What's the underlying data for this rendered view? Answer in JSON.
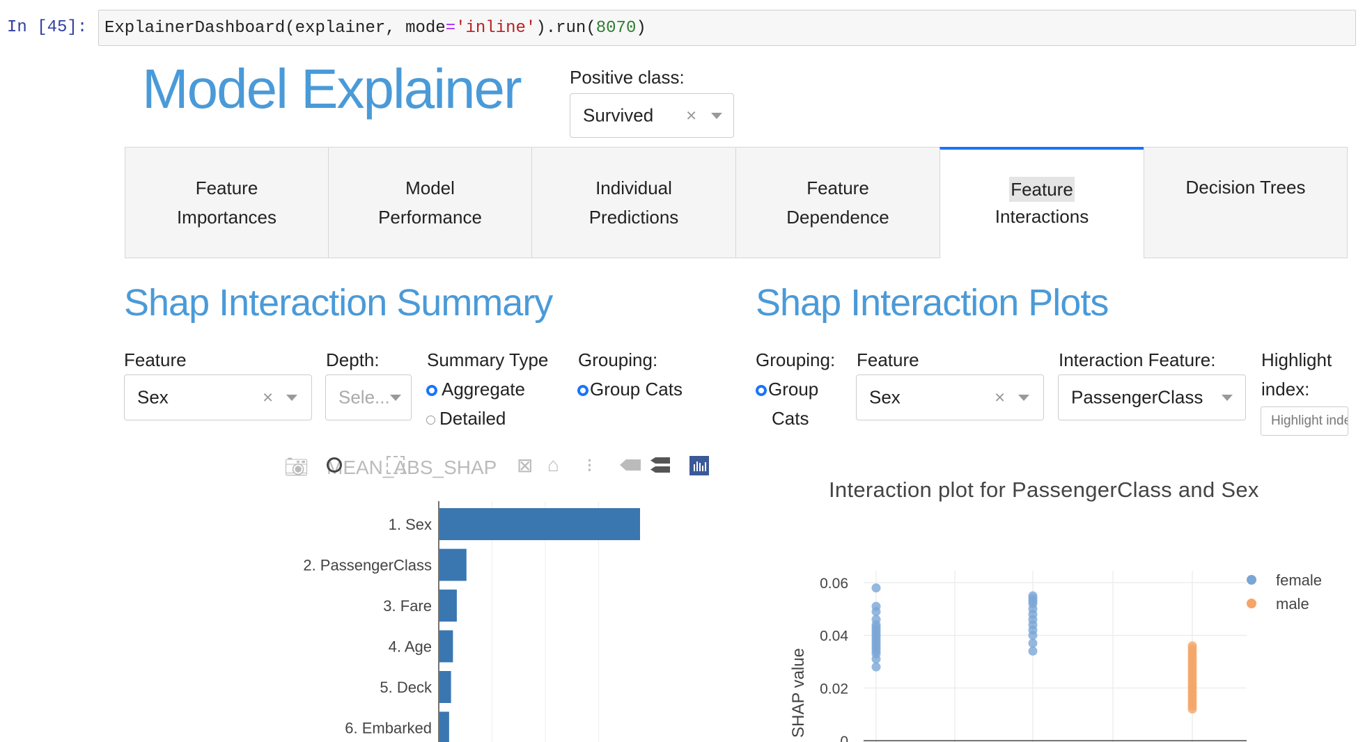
{
  "cell": {
    "prompt": "In [45]:",
    "code_prefix": "ExplainerDashboard(explainer, mode",
    "code_eq": "=",
    "code_str": "'inline'",
    "code_mid": ").run(",
    "code_num": "8070",
    "code_end": ")"
  },
  "header": {
    "title": "Model Explainer",
    "positive_class_label": "Positive class:",
    "positive_class_value": "Survived"
  },
  "tabs": [
    {
      "line1": "Feature",
      "line2": "Importances"
    },
    {
      "line1": "Model",
      "line2": "Performance"
    },
    {
      "line1": "Individual",
      "line2": "Predictions"
    },
    {
      "line1": "Feature",
      "line2": "Dependence"
    },
    {
      "line1": "Feature",
      "line2": "Interactions"
    },
    {
      "line1": "Decision Trees",
      "line2": ""
    }
  ],
  "summary": {
    "title": "Shap Interaction Summary",
    "feature_label": "Feature",
    "feature_value": "Sex",
    "depth_label": "Depth:",
    "depth_placeholder": "Sele...",
    "summary_type_label": "Summary Type",
    "summary_opt_aggregate": "Aggregate",
    "summary_opt_detailed": "Detailed",
    "grouping_label": "Grouping:",
    "grouping_opt": "Group Cats",
    "plot_title_overlay": "MEAN_ABS_SHAP"
  },
  "plots": {
    "title": "Shap Interaction Plots",
    "grouping_label": "Grouping:",
    "grouping_opt_line1": "Group",
    "grouping_opt_line2": "Cats",
    "feature_label": "Feature",
    "feature_value": "Sex",
    "interaction_label": "Interaction Feature:",
    "interaction_value": "PassengerClass",
    "highlight_label_line1": "Highlight",
    "highlight_label_line2": "index:",
    "highlight_placeholder": "Highlight index",
    "plot_title": "Interaction plot for PassengerClass and Sex",
    "ylabel": "SHAP value",
    "legend_female": "female",
    "legend_male": "male"
  },
  "chart_data": [
    {
      "type": "bar",
      "orientation": "horizontal",
      "categories": [
        "1. Sex",
        "2. PassengerClass",
        "3. Fare",
        "4. Age",
        "5. Deck",
        "6. Embarked"
      ],
      "values": [
        0.104,
        0.014,
        0.009,
        0.007,
        0.006,
        0.005
      ],
      "title": "",
      "xlabel": "",
      "ylabel": "",
      "color": "#3a77b0"
    },
    {
      "type": "scatter",
      "title": "Interaction plot for PassengerClass and Sex",
      "ylabel": "SHAP value",
      "yticks": [
        0,
        0.02,
        0.04,
        0.06
      ],
      "ylim": [
        -0.002,
        0.066
      ],
      "legend": "top-right",
      "series": [
        {
          "name": "female",
          "color": "#7aa6d6",
          "points": [
            [
              1,
              0.058
            ],
            [
              1,
              0.051
            ],
            [
              1,
              0.049
            ],
            [
              1,
              0.046
            ],
            [
              1,
              0.044
            ],
            [
              1,
              0.043
            ],
            [
              1,
              0.042
            ],
            [
              1,
              0.041
            ],
            [
              1,
              0.04
            ],
            [
              1,
              0.039
            ],
            [
              1,
              0.038
            ],
            [
              1,
              0.037
            ],
            [
              1,
              0.036
            ],
            [
              1,
              0.035
            ],
            [
              1,
              0.034
            ],
            [
              1,
              0.033
            ],
            [
              1,
              0.031
            ],
            [
              1,
              0.028
            ],
            [
              2,
              0.055
            ],
            [
              2,
              0.054
            ],
            [
              2,
              0.053
            ],
            [
              2,
              0.052
            ],
            [
              2,
              0.05
            ],
            [
              2,
              0.048
            ],
            [
              2,
              0.046
            ],
            [
              2,
              0.044
            ],
            [
              2,
              0.042
            ],
            [
              2,
              0.04
            ],
            [
              2,
              0.037
            ],
            [
              2,
              0.034
            ]
          ]
        },
        {
          "name": "male",
          "color": "#f4a66a",
          "points": [
            [
              3,
              0.036
            ],
            [
              3,
              0.035
            ],
            [
              3,
              0.034
            ],
            [
              3,
              0.033
            ],
            [
              3,
              0.032
            ],
            [
              3,
              0.031
            ],
            [
              3,
              0.03
            ],
            [
              3,
              0.029
            ],
            [
              3,
              0.028
            ],
            [
              3,
              0.027
            ],
            [
              3,
              0.026
            ],
            [
              3,
              0.025
            ],
            [
              3,
              0.024
            ],
            [
              3,
              0.023
            ],
            [
              3,
              0.022
            ],
            [
              3,
              0.021
            ],
            [
              3,
              0.02
            ],
            [
              3,
              0.019
            ],
            [
              3,
              0.018
            ],
            [
              3,
              0.017
            ],
            [
              3,
              0.016
            ],
            [
              3,
              0.015
            ],
            [
              3,
              0.014
            ],
            [
              3,
              0.013
            ],
            [
              3,
              0.012
            ]
          ]
        }
      ]
    }
  ],
  "icons": {
    "camera": "camera-icon",
    "zoom": "zoom-icon",
    "pan": "pan-icon",
    "box_select": "box-select-icon",
    "zoom_in": "zoom-in-icon",
    "zoom_out": "zoom-out-icon",
    "autoscale": "autoscale-icon",
    "reset": "home-icon",
    "spike": "spike-icon",
    "hover_closest": "hover-closest-icon",
    "hover_compare": "hover-compare-icon",
    "plotly_logo": "plotly-logo-icon"
  },
  "colors": {
    "title": "#4a9ad8",
    "tab_active": "#1975fa",
    "bar": "#3a77b0",
    "female": "#7aa6d6",
    "male": "#f4a66a"
  }
}
